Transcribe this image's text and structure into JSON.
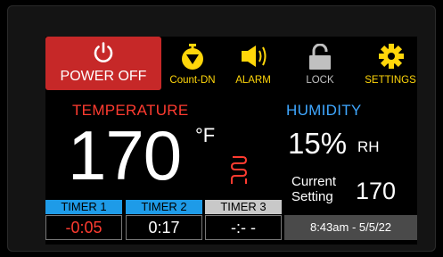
{
  "toolbar": {
    "power_label": "POWER OFF",
    "countdown_label": "Count-DN",
    "alarm_label": "ALARM",
    "lock_label": "LOCK",
    "settings_label": "SETTINGS"
  },
  "temperature": {
    "label": "TEMPERATURE",
    "value": "170",
    "unit": "°F"
  },
  "humidity": {
    "label": "HUMIDITY",
    "value": "15%",
    "unit": "RH",
    "setting_label_1": "Current",
    "setting_label_2": "Setting",
    "setting_value": "170"
  },
  "timers": [
    {
      "label": "TIMER 1",
      "value": "-0:05",
      "tab_color": "#1e9be8",
      "value_color": "#ff3b30"
    },
    {
      "label": "TIMER 2",
      "value": "0:17",
      "tab_color": "#1e9be8",
      "value_color": "#ffffff"
    },
    {
      "label": "TIMER 3",
      "value": "-:- -",
      "tab_color": "#c8c8c8",
      "value_color": "#ffffff"
    }
  ],
  "datetime": "8:43am - 5/5/22",
  "colors": {
    "power": "#c62828",
    "accent_yellow": "#ffd60a",
    "temp_red": "#ff3b30",
    "humidity_blue": "#3fa7ff"
  },
  "icons": [
    "power-icon",
    "stopwatch-icon",
    "speaker-icon",
    "padlock-icon",
    "gear-icon",
    "heater-coil-icon"
  ]
}
